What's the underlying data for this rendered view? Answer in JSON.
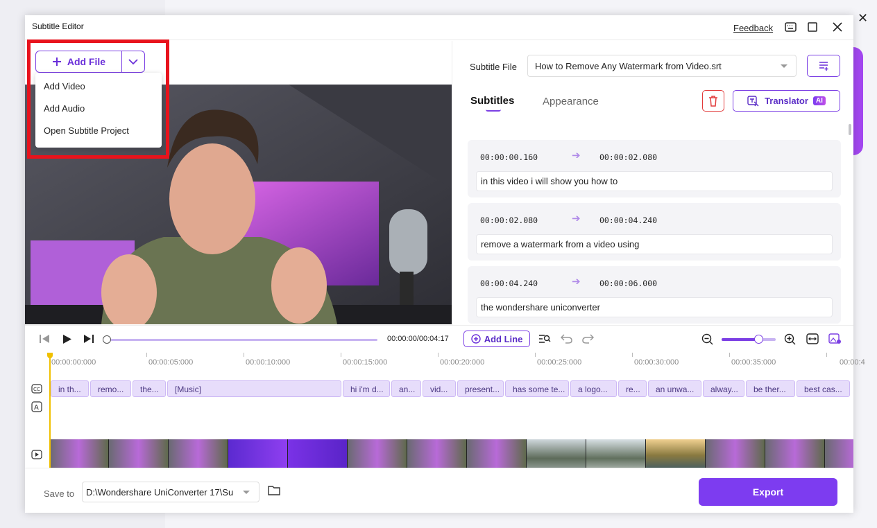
{
  "dialog": {
    "title": "Subtitle Editor",
    "feedback": "Feedback"
  },
  "add_file": {
    "label": "Add File",
    "menu": [
      "Add Video",
      "Add Audio",
      "Open Subtitle Project"
    ]
  },
  "subtitle_file": {
    "label": "Subtitle File",
    "value": "How to Remove Any Watermark from Video.srt"
  },
  "tabs": {
    "subtitles": "Subtitles",
    "appearance": "Appearance"
  },
  "translator": {
    "label": "Translator",
    "badge": "AI"
  },
  "entries": [
    {
      "start": "00:00:00.160",
      "end": "00:00:02.080",
      "text": "in this video i will show you how to"
    },
    {
      "start": "00:00:02.080",
      "end": "00:00:04.240",
      "text": "remove a watermark from a video using"
    },
    {
      "start": "00:00:04.240",
      "end": "00:00:06.000",
      "text": "the wondershare uniconverter"
    }
  ],
  "player": {
    "time": "00:00:00/00:04:17",
    "add_line": "Add Line"
  },
  "ruler": [
    "00:00:00:000",
    "00:00:05:000",
    "00:00:10:000",
    "00:00:15:000",
    "00:00:20:000",
    "00:00:25:000",
    "00:00:30:000",
    "00:00:35:000",
    "00:00:4"
  ],
  "chips": [
    "in th...",
    "remo...",
    "the...",
    "[Music]",
    "hi i'm d...",
    "an...",
    "vid...",
    "present...",
    "has some te...",
    "a logo...",
    "re...",
    "an unwa...",
    "alway...",
    "be ther...",
    "best cas..."
  ],
  "bottom": {
    "save_to": "Save to",
    "path": "D:\\Wondershare UniConverter 17\\Su",
    "export": "Export"
  },
  "colors": {
    "accent": "#7d3cf0",
    "highlight": "#e8131c",
    "playhead": "#f0c000"
  }
}
